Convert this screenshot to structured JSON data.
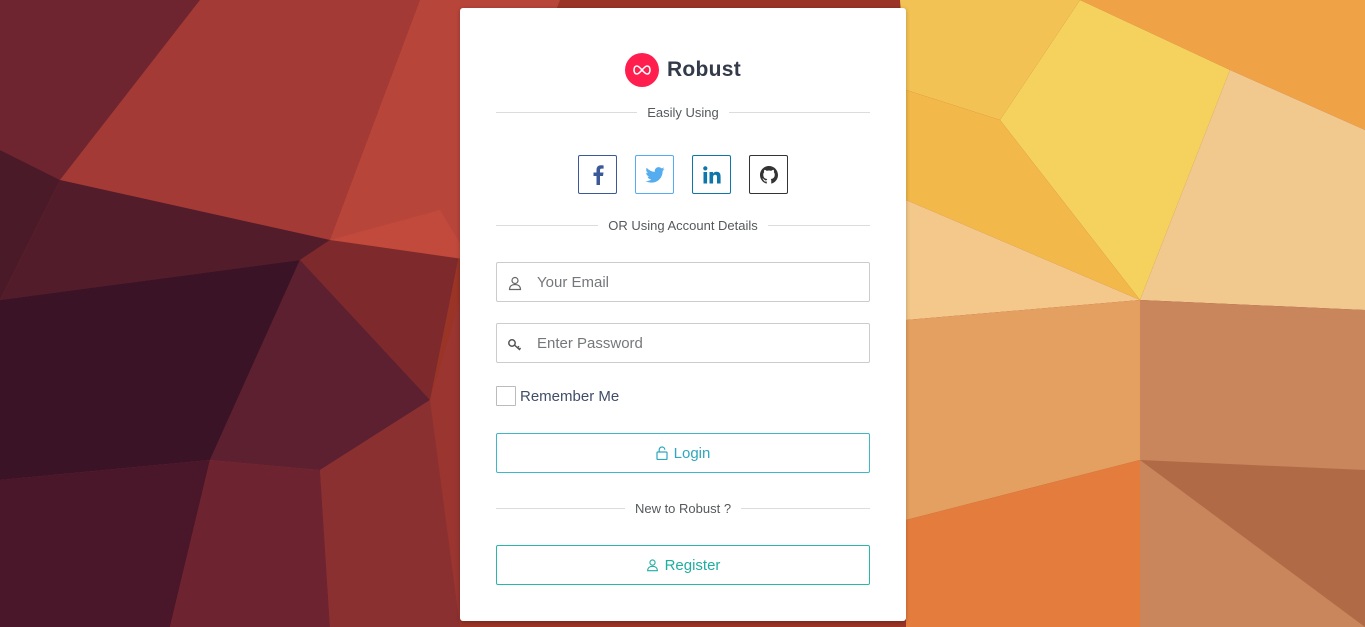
{
  "brand": {
    "name": "Robust",
    "logo_icon": "infinity-icon",
    "logo_color": "#ff1e4e"
  },
  "social_section": {
    "divider_text": "Easily Using",
    "buttons": [
      {
        "icon": "facebook-icon",
        "color": "#3b5998"
      },
      {
        "icon": "twitter-icon",
        "color": "#55acee"
      },
      {
        "icon": "linkedin-icon",
        "color": "#0e76a8"
      },
      {
        "icon": "github-icon",
        "color": "#333333"
      }
    ]
  },
  "account_divider_text": "OR Using Account Details",
  "form": {
    "email_placeholder": "Your Email",
    "email_value": "",
    "password_placeholder": "Enter Password",
    "password_value": "",
    "remember_label": "Remember Me",
    "remember_checked": false,
    "login_label": "Login"
  },
  "register_section": {
    "divider_text": "New to Robust ?",
    "register_label": "Register"
  },
  "colors": {
    "login": "#2fa7bd",
    "register": "#1fae9f"
  }
}
